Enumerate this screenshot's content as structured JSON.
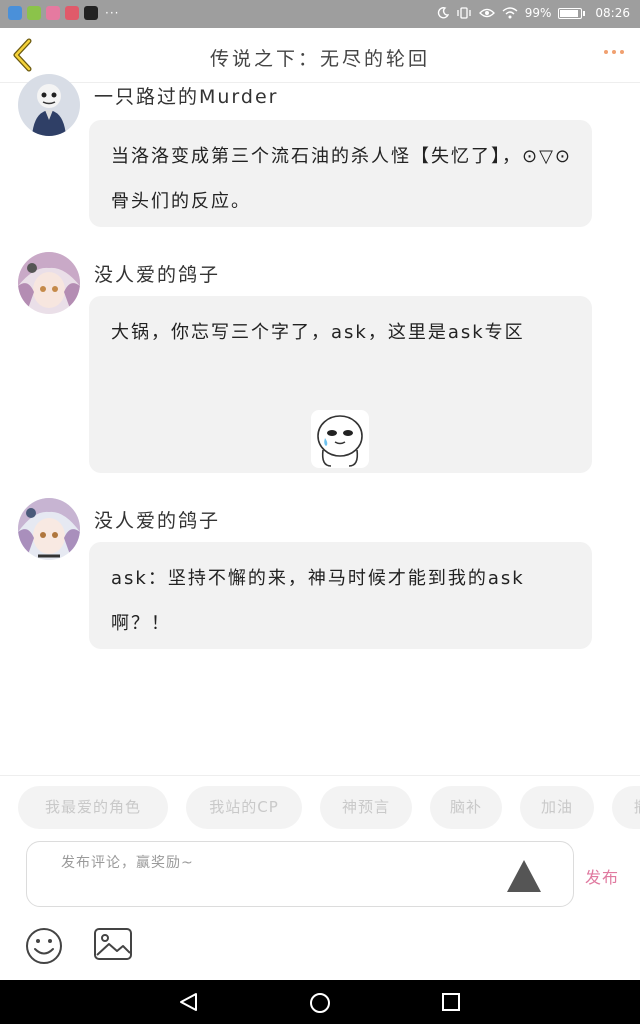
{
  "status_bar": {
    "battery_percent": "99%",
    "time": "08:26",
    "more_apps": "···"
  },
  "header": {
    "title": "传说之下：无尽的轮回",
    "back_icon": "chevron-left-icon",
    "more_icon": "more-dots-icon"
  },
  "comments": [
    {
      "username": "一只路过的Murder",
      "text": "当洛洛变成第三个流石油的杀人怪【失忆了】，⊙▽⊙骨头们的反应。",
      "has_sticker": false
    },
    {
      "username": "没人爱的鸽子",
      "text": "大锅，你忘写三个字了，ask，这里是ask专区",
      "has_sticker": true
    },
    {
      "username": "没人爱的鸽子",
      "text": "ask：坚持不懈的来，神马时候才能到我的ask啊？！",
      "has_sticker": false
    }
  ],
  "quick_tags": [
    "我最爱的角色",
    "我站的CP",
    "神预言",
    "脑补",
    "加油",
    "撒"
  ],
  "composer": {
    "placeholder": "发布评论，赢奖励~",
    "publish_label": "发布"
  },
  "colors": {
    "status_bar": "#9e9e9e",
    "accent_orange": "#f0a070",
    "publish_pink": "#e07aa0",
    "bubble_bg": "#f2f2f2",
    "tag_bg": "#f3f3f3"
  }
}
